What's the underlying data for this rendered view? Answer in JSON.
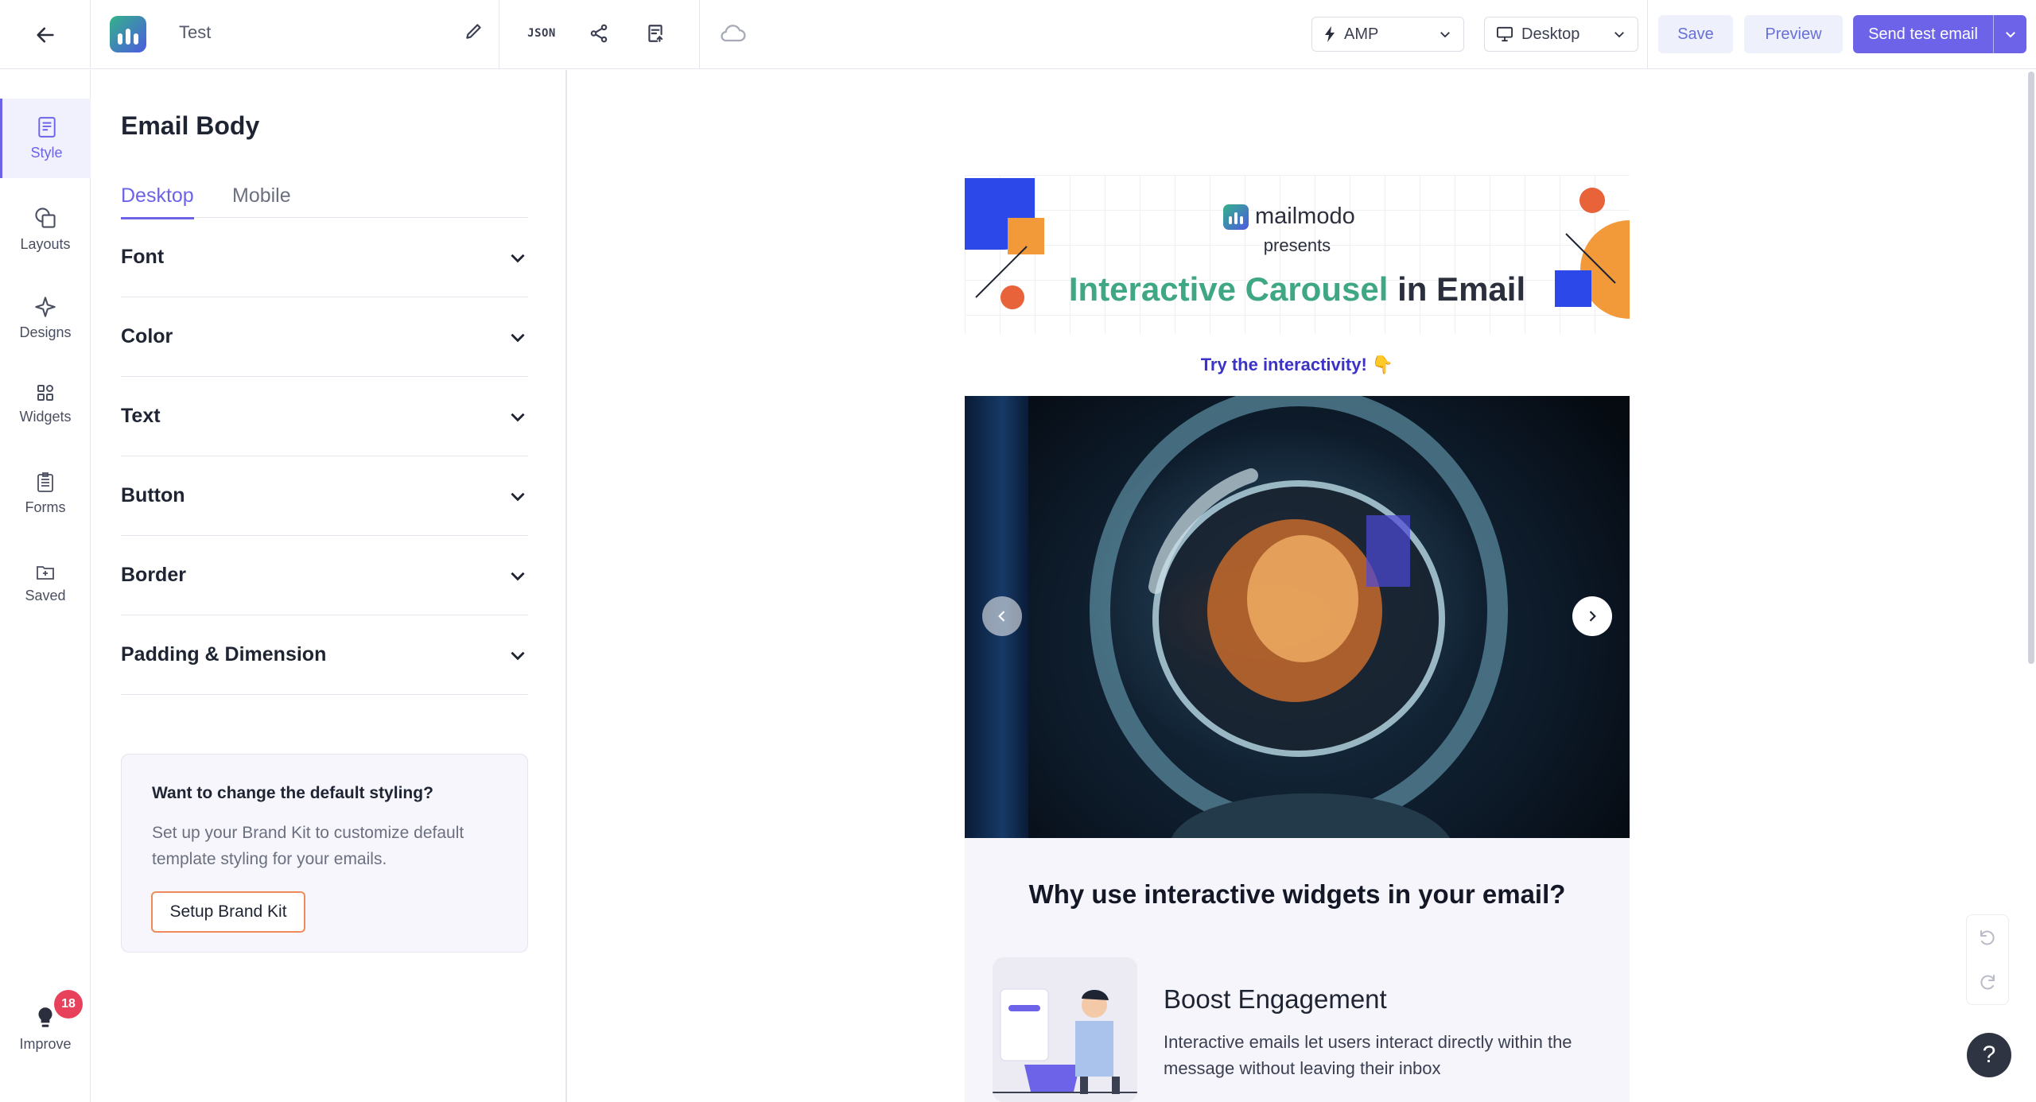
{
  "topbar": {
    "title": "Test",
    "json_label": "JSON",
    "format_select": "AMP",
    "device_select": "Desktop",
    "save_label": "Save",
    "preview_label": "Preview",
    "send_label": "Send test email"
  },
  "rail": {
    "items": [
      {
        "label": "Style",
        "icon": "style-icon"
      },
      {
        "label": "Layouts",
        "icon": "layouts-icon"
      },
      {
        "label": "Designs",
        "icon": "designs-icon"
      },
      {
        "label": "Widgets",
        "icon": "widgets-icon"
      },
      {
        "label": "Forms",
        "icon": "forms-icon"
      },
      {
        "label": "Saved",
        "icon": "saved-icon"
      }
    ],
    "improve": {
      "label": "Improve",
      "badge": "18"
    }
  },
  "panel": {
    "title": "Email Body",
    "tabs": [
      {
        "label": "Desktop"
      },
      {
        "label": "Mobile"
      }
    ],
    "sections": [
      {
        "label": "Font"
      },
      {
        "label": "Color"
      },
      {
        "label": "Text"
      },
      {
        "label": "Button"
      },
      {
        "label": "Border"
      },
      {
        "label": "Padding & Dimension"
      }
    ],
    "brandkit": {
      "question": "Want to change the default styling?",
      "description": "Set up your Brand Kit to customize default template styling for your emails.",
      "button": "Setup Brand Kit"
    }
  },
  "email": {
    "brand": "mailmodo",
    "presents": "presents",
    "headline_highlight": "Interactive Carousel",
    "headline_rest": "in Email",
    "try_text": "Try the interactivity! 👇",
    "why_title": "Why use interactive widgets in your email?",
    "feature_title": "Boost Engagement",
    "feature_desc": "Interactive emails let users interact directly within the message without leaving their inbox"
  },
  "help_label": "?",
  "colors": {
    "accent": "#6c63e8",
    "green": "#3fa784",
    "orange": "#f29a3a",
    "blue": "#2d48e8"
  }
}
